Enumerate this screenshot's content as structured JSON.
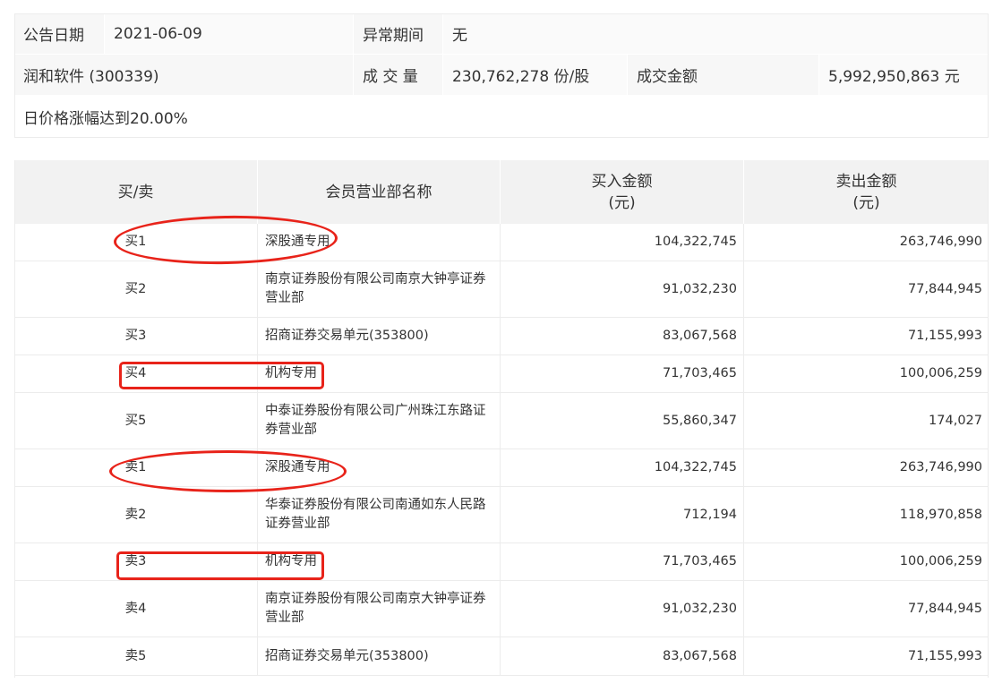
{
  "info": {
    "date_label": "公告日期",
    "date_value": "2021-06-09",
    "abnormal_label": "异常期间",
    "abnormal_value": "无",
    "stock_name": "润和软件 (300339)",
    "volume_label": "成 交 量",
    "volume_value": "230,762,278 份/股",
    "amount_label": "成交金额",
    "amount_value": "5,992,950,863 元",
    "reason": "日价格涨幅达到20.00%"
  },
  "table": {
    "headers": {
      "side": "买/卖",
      "broker": "会员营业部名称",
      "buy_line1": "买入金额",
      "buy_line2": "(元)",
      "sell_line1": "卖出金额",
      "sell_line2": "(元)"
    },
    "rows": [
      {
        "side": "买1",
        "broker": "深股通专用",
        "buy": "104,322,745",
        "sell": "263,746,990"
      },
      {
        "side": "买2",
        "broker": "南京证券股份有限公司南京大钟亭证券营业部",
        "buy": "91,032,230",
        "sell": "77,844,945"
      },
      {
        "side": "买3",
        "broker": "招商证券交易单元(353800)",
        "buy": "83,067,568",
        "sell": "71,155,993"
      },
      {
        "side": "买4",
        "broker": "机构专用",
        "buy": "71,703,465",
        "sell": "100,006,259"
      },
      {
        "side": "买5",
        "broker": "中泰证券股份有限公司广州珠江东路证券营业部",
        "buy": "55,860,347",
        "sell": "174,027"
      },
      {
        "side": "卖1",
        "broker": "深股通专用",
        "buy": "104,322,745",
        "sell": "263,746,990"
      },
      {
        "side": "卖2",
        "broker": "华泰证券股份有限公司南通如东人民路证券营业部",
        "buy": "712,194",
        "sell": "118,970,858"
      },
      {
        "side": "卖3",
        "broker": "机构专用",
        "buy": "71,703,465",
        "sell": "100,006,259"
      },
      {
        "side": "卖4",
        "broker": "南京证券股份有限公司南京大钟亭证券营业部",
        "buy": "91,032,230",
        "sell": "77,844,945"
      },
      {
        "side": "卖5",
        "broker": "招商证券交易单元(353800)",
        "buy": "83,067,568",
        "sell": "71,155,993"
      }
    ]
  },
  "colors": {
    "annotation": "#e8231a",
    "header_bg": "#f2f2f2",
    "info_bg": "#f7f7f7"
  }
}
